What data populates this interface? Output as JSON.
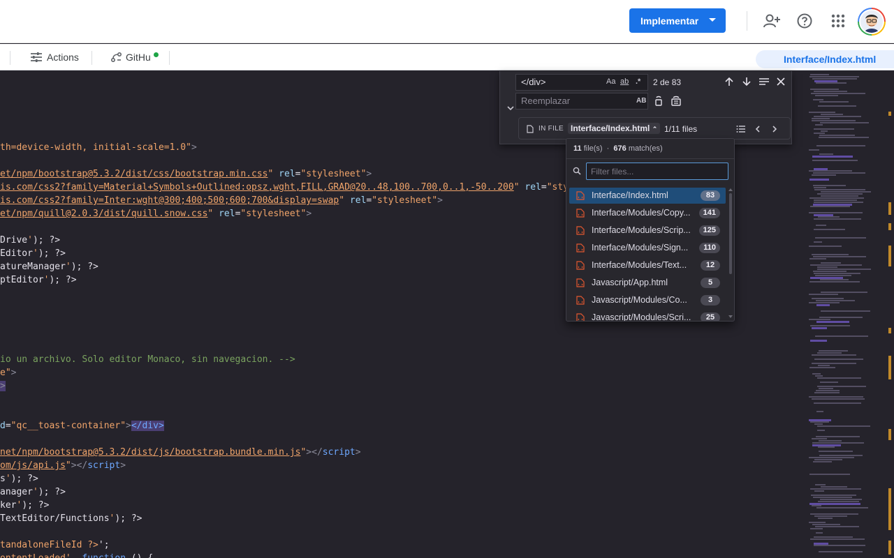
{
  "header": {
    "deploy_label": "Implementar",
    "icons": [
      "add-person-icon",
      "help-icon",
      "apps-grid-icon"
    ]
  },
  "toolbar": {
    "actions_label": "Actions",
    "github_label": "GitHu",
    "open_file": "Interface/Index.html"
  },
  "editor": {
    "lines": [
      {
        "segments": [
          {
            "t": "th=device-width, initial-scale=1.0\"",
            "c": "c-str"
          },
          {
            "t": ">",
            "c": "c-punc"
          }
        ]
      },
      {
        "segments": [
          {
            "t": "et/npm/bootstrap@5.3.2/dist/css/bootstrap.min.css",
            "c": "c-url"
          },
          {
            "t": "\" ",
            "c": "c-str"
          },
          {
            "t": "rel",
            "c": "c-attr"
          },
          {
            "t": "=",
            "c": ""
          },
          {
            "t": "\"stylesheet\"",
            "c": "c-str"
          },
          {
            "t": ">",
            "c": "c-punc"
          }
        ]
      },
      {
        "segments": [
          {
            "t": "is.com/css2?family=Material+Symbols+Outlined:opsz,wght,FILL,GRAD@20..48,100..700,0..1,-50..200",
            "c": "c-url"
          },
          {
            "t": "\" ",
            "c": "c-str"
          },
          {
            "t": "rel",
            "c": "c-attr"
          },
          {
            "t": "=",
            "c": ""
          },
          {
            "t": "\"sty",
            "c": "c-str"
          }
        ]
      },
      {
        "segments": [
          {
            "t": "is.com/css2?family=Inter:wght@300;400;500;600;700&display=swap",
            "c": "c-url"
          },
          {
            "t": "\" ",
            "c": "c-str"
          },
          {
            "t": "rel",
            "c": "c-attr"
          },
          {
            "t": "=",
            "c": ""
          },
          {
            "t": "\"stylesheet\"",
            "c": "c-str"
          },
          {
            "t": ">",
            "c": "c-punc"
          }
        ]
      },
      {
        "segments": [
          {
            "t": "et/npm/quill@2.0.3/dist/quill.snow.css",
            "c": "c-url"
          },
          {
            "t": "\" ",
            "c": "c-str"
          },
          {
            "t": "rel",
            "c": "c-attr"
          },
          {
            "t": "=",
            "c": ""
          },
          {
            "t": "\"stylesheet\"",
            "c": "c-str"
          },
          {
            "t": ">",
            "c": "c-punc"
          }
        ]
      },
      {
        "segments": [
          {
            "t": "Drive",
            "c": ""
          },
          {
            "t": "'",
            "c": "c-str"
          },
          {
            "t": "); ?>",
            "c": ""
          }
        ]
      },
      {
        "segments": [
          {
            "t": "Editor",
            "c": ""
          },
          {
            "t": "'",
            "c": "c-str"
          },
          {
            "t": "); ?>",
            "c": ""
          }
        ]
      },
      {
        "segments": [
          {
            "t": "atureManager",
            "c": ""
          },
          {
            "t": "'",
            "c": "c-str"
          },
          {
            "t": "); ?>",
            "c": ""
          }
        ]
      },
      {
        "segments": [
          {
            "t": "ptEditor",
            "c": ""
          },
          {
            "t": "'",
            "c": "c-str"
          },
          {
            "t": "); ?>",
            "c": ""
          }
        ]
      },
      {
        "segments": [
          {
            "t": "io un archivo. Solo editor Monaco, sin navegacion. -->",
            "c": "c-cmt"
          }
        ]
      },
      {
        "segments": [
          {
            "t": "e\"",
            "c": "c-str"
          },
          {
            "t": ">",
            "c": "c-punc"
          }
        ]
      },
      {
        "segments": [
          {
            "t": ">",
            "c": "c-punc c-hl"
          }
        ]
      },
      {
        "segments": [
          {
            "t": "d",
            "c": "c-attr"
          },
          {
            "t": "=",
            "c": ""
          },
          {
            "t": "\"qc__toast-container\"",
            "c": "c-str"
          },
          {
            "t": ">",
            "c": "c-punc"
          },
          {
            "t": "</div>",
            "c": "c-tag c-hl"
          }
        ]
      },
      {
        "segments": [
          {
            "t": "net/npm/bootstrap@5.3.2/dist/js/bootstrap.bundle.min.js",
            "c": "c-url"
          },
          {
            "t": "\"",
            "c": "c-str"
          },
          {
            "t": "></",
            "c": "c-punc"
          },
          {
            "t": "script",
            "c": "c-tag"
          },
          {
            "t": ">",
            "c": "c-punc"
          }
        ]
      },
      {
        "segments": [
          {
            "t": "om/js/api.js",
            "c": "c-url"
          },
          {
            "t": "\"",
            "c": "c-str"
          },
          {
            "t": "></",
            "c": "c-punc"
          },
          {
            "t": "script",
            "c": "c-tag"
          },
          {
            "t": ">",
            "c": "c-punc"
          }
        ]
      },
      {
        "segments": [
          {
            "t": "s",
            "c": ""
          },
          {
            "t": "'",
            "c": "c-str"
          },
          {
            "t": "); ?>",
            "c": ""
          }
        ]
      },
      {
        "segments": [
          {
            "t": "anager",
            "c": ""
          },
          {
            "t": "'",
            "c": "c-str"
          },
          {
            "t": "); ?>",
            "c": ""
          }
        ]
      },
      {
        "segments": [
          {
            "t": "ker",
            "c": ""
          },
          {
            "t": "'",
            "c": "c-str"
          },
          {
            "t": "); ?>",
            "c": ""
          }
        ]
      },
      {
        "segments": [
          {
            "t": "TextEditor/Functions",
            "c": ""
          },
          {
            "t": "'",
            "c": "c-str"
          },
          {
            "t": "); ?>",
            "c": ""
          }
        ]
      },
      {
        "segments": [
          {
            "t": "tandaloneFileId ?>",
            "c": "c-str"
          },
          {
            "t": "';",
            "c": ""
          }
        ]
      },
      {
        "segments": [
          {
            "t": "ontentLoaded'",
            "c": "c-str"
          },
          {
            "t": ", ",
            "c": ""
          },
          {
            "t": "function",
            "c": "c-tag"
          },
          {
            "t": " () {",
            "c": ""
          }
        ]
      }
    ]
  },
  "find": {
    "search_value": "</div>",
    "replace_placeholder": "Reemplazar",
    "opt_case": "Aa",
    "opt_word": "ab",
    "opt_regex": ".*",
    "match_count": "2 de 83",
    "preserve_case": "AB",
    "scope_label": "IN FILE",
    "scope_file": "Interface/Index.html",
    "scope_count": "1/11 files"
  },
  "dropdown": {
    "files_count": "11",
    "files_label": "file(s)",
    "separator": "·",
    "match_count": "676",
    "match_label": "match(es)",
    "filter_placeholder": "Filter files...",
    "items": [
      {
        "name": "Interface/Index.html",
        "count": "83"
      },
      {
        "name": "Interface/Modules/Copy...",
        "count": "141"
      },
      {
        "name": "Interface/Modules/Scrip...",
        "count": "125"
      },
      {
        "name": "Interface/Modules/Sign...",
        "count": "110"
      },
      {
        "name": "Interface/Modules/Text...",
        "count": "12"
      },
      {
        "name": "Javascript/App.html",
        "count": "5"
      },
      {
        "name": "Javascript/Modules/Co...",
        "count": "3"
      },
      {
        "name": "Javascript/Modules/Scri...",
        "count": "25"
      }
    ]
  },
  "colors": {
    "accent": "#1a73e8",
    "editor_bg": "#25232b",
    "selected_row": "#1f4d79",
    "status_green": "#1ea446"
  }
}
